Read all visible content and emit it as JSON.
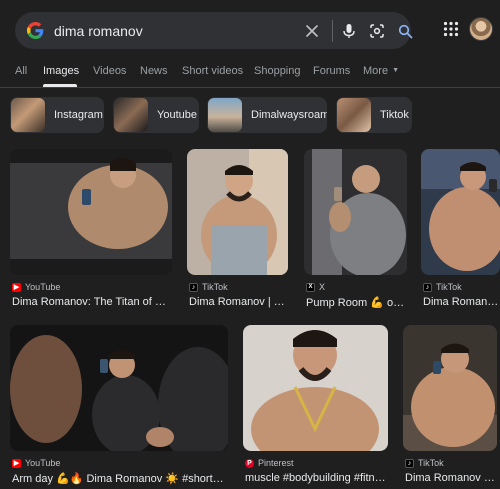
{
  "search": {
    "query": "dima romanov"
  },
  "tabs": [
    {
      "label": "All"
    },
    {
      "label": "Images"
    },
    {
      "label": "Videos"
    },
    {
      "label": "News"
    },
    {
      "label": "Short videos"
    },
    {
      "label": "Shopping"
    },
    {
      "label": "Forums"
    },
    {
      "label": "More"
    }
  ],
  "active_tab": "Images",
  "chips": [
    {
      "label": "Instagram"
    },
    {
      "label": "Youtube"
    },
    {
      "label": "Dimalwaysroam"
    },
    {
      "label": "Tiktok"
    }
  ],
  "results": [
    {
      "source": "YouTube",
      "title": "Dima Romanov: The Titan of Na..."
    },
    {
      "source": "TikTok",
      "title": "Dima Romanov | Ti..."
    },
    {
      "source": "X",
      "title": "Pump Room 💪 on ..."
    },
    {
      "source": "TikTok",
      "title": "Dima Romanov | T..."
    },
    {
      "source": "YouTube",
      "title": "Arm day 💪🔥 Dima Romanov ☀️ #shorts ..."
    },
    {
      "source": "Pinterest",
      "title": "muscle #bodybuilding #fitne..."
    },
    {
      "source": "TikTok",
      "title": "Dima Romanov | T..."
    }
  ],
  "colors": {
    "background": "#1f1f1f",
    "search_box": "#303134",
    "chip": "#303134",
    "text": "#e8eaed",
    "muted": "#9aa0a6",
    "youtube": "#ff0000",
    "pinterest": "#e60023"
  }
}
